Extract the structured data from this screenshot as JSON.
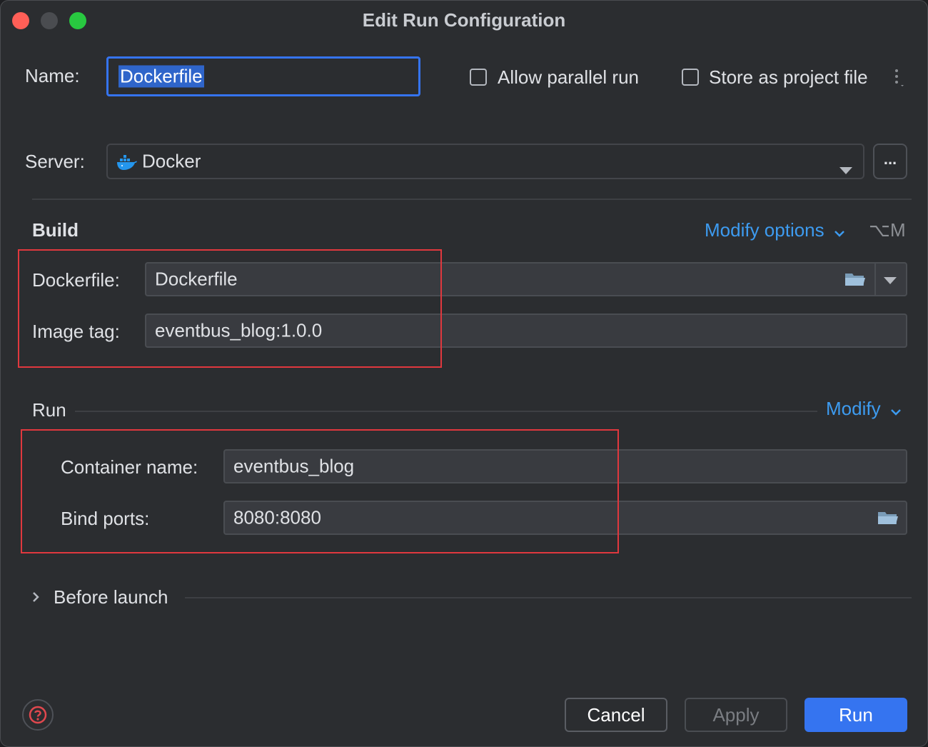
{
  "window": {
    "title": "Edit Run Configuration"
  },
  "header": {
    "name_label": "Name:",
    "name_value": "Dockerfile",
    "allow_parallel_label": "Allow parallel run",
    "allow_parallel_checked": false,
    "store_project_label": "Store as project file",
    "store_project_checked": false
  },
  "server": {
    "label": "Server:",
    "value": "Docker",
    "more_button": "..."
  },
  "build": {
    "title": "Build",
    "modify_options_label": "Modify options",
    "modify_options_shortcut": "⌥M",
    "dockerfile_label": "Dockerfile:",
    "dockerfile_value": "Dockerfile",
    "image_tag_label": "Image tag:",
    "image_tag_value": "eventbus_blog:1.0.0"
  },
  "run": {
    "title": "Run",
    "modify_label": "Modify",
    "container_name_label": "Container name:",
    "container_name_value": "eventbus_blog",
    "bind_ports_label": "Bind ports:",
    "bind_ports_value": "8080:8080"
  },
  "before_launch": {
    "label": "Before launch"
  },
  "footer": {
    "cancel_label": "Cancel",
    "apply_label": "Apply",
    "run_label": "Run"
  },
  "colors": {
    "accent": "#3574f0",
    "link": "#3d9bf0",
    "highlight_box": "#e0383e"
  }
}
